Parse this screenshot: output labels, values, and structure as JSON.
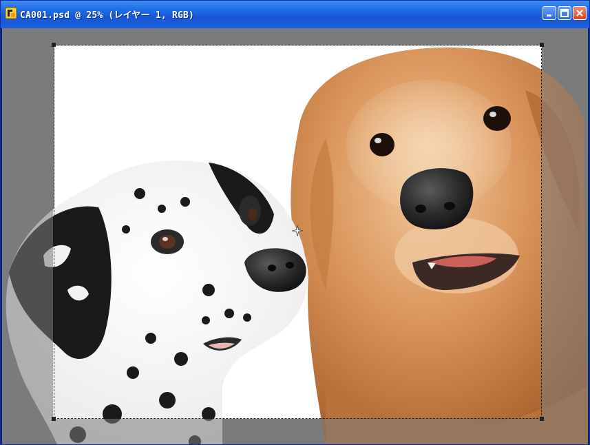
{
  "window": {
    "title": "CA001.psd @ 25% (レイヤー 1, RGB)"
  },
  "icons": {
    "app": "photoshop-document-icon",
    "minimize": "minimize-icon",
    "maximize": "maximize-icon",
    "close": "close-icon",
    "cursor": "transform-cursor-icon"
  },
  "colors": {
    "titlebar": "#1f6be5",
    "workspace": "#7b7b7b",
    "canvas": "#ffffff"
  }
}
